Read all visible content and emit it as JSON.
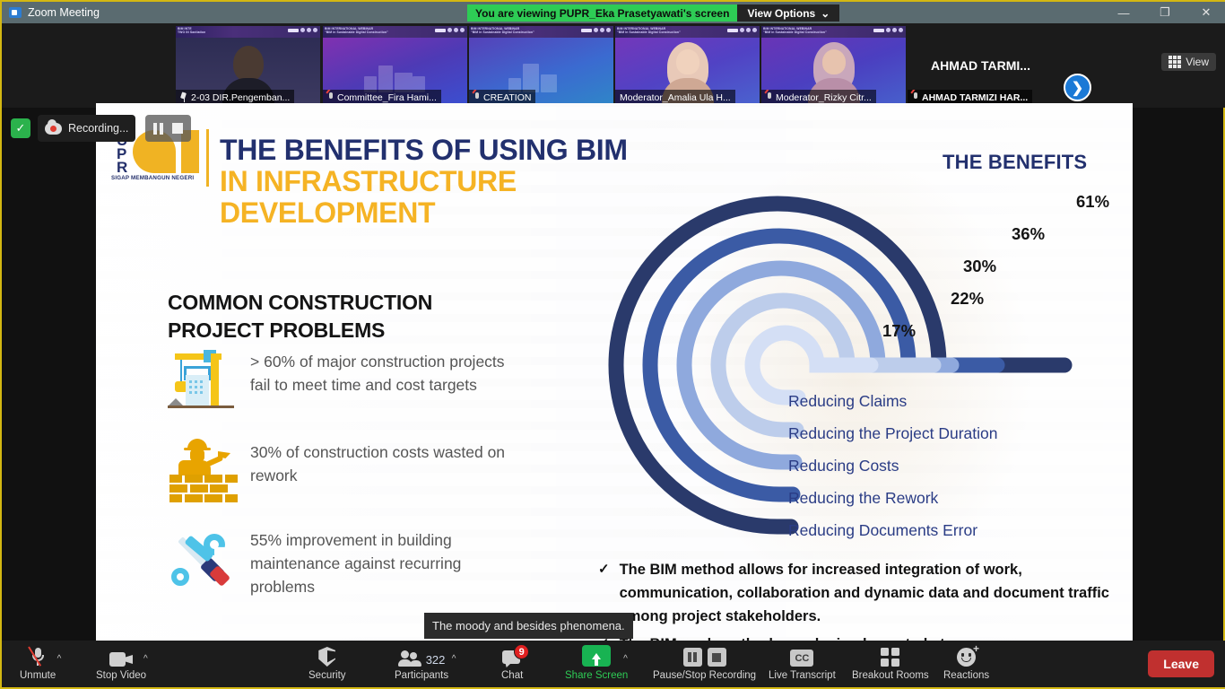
{
  "window": {
    "app_icon": "zoom-icon",
    "title": "Zoom Meeting",
    "viewing_banner": "You are viewing PUPR_Eka Prasetyawati's screen",
    "view_options_label": "View Options",
    "view_options_caret": "⌄",
    "minimize": "—",
    "restore": "❐",
    "close": "✕"
  },
  "filmstrip": {
    "view_button": "View",
    "next_arrow": "❯",
    "tiles": [
      {
        "label": "2-03 DIR.Pengemban...",
        "icon": "pin-icon",
        "active": true,
        "kind": "video"
      },
      {
        "label": "Committee_Fira Hami...",
        "icon": "mic-muted-icon",
        "active": false,
        "kind": "avatar-empty"
      },
      {
        "label": "CREATION",
        "icon": "mic-muted-icon",
        "active": false,
        "kind": "avatar-empty"
      },
      {
        "label": "Moderator_Amalia Ula H...",
        "icon": "",
        "active": false,
        "kind": "video-hijab"
      },
      {
        "label": "Moderator_Rizky Citr...",
        "icon": "mic-muted-icon",
        "active": false,
        "kind": "video-hijab"
      },
      {
        "label": "AHMAD TARMIZI HAR...",
        "icon": "mic-muted-icon",
        "active": false,
        "kind": "name-only",
        "name_display": "AHMAD TARMI..."
      }
    ]
  },
  "recording": {
    "shield_icon": "security-shield-icon",
    "shield_glyph": "✓",
    "cloud_icon": "cloud-recording-icon",
    "status_text": "Recording...",
    "pause_icon": "pause-icon",
    "stop_icon": "stop-icon"
  },
  "slide": {
    "logo": {
      "letters": [
        "U",
        "P",
        "R"
      ],
      "tagline": "SIGAP MEMBANGUN NEGERI"
    },
    "title_line1": "THE BENEFITS OF USING BIM",
    "title_line2": "IN INFRASTRUCTURE",
    "title_line3": "DEVELOPMENT",
    "title_color_1": "#22306e",
    "title_color_2": "#f5b324",
    "problems_heading_l1": "COMMON CONSTRUCTION",
    "problems_heading_l2": "PROJECT PROBLEMS",
    "problems": [
      {
        "icon": "crane-icon",
        "text": "> 60% of major construction projects fail to meet time and cost targets"
      },
      {
        "icon": "mason-bricklayer-icon",
        "text": "30% of construction costs wasted on rework"
      },
      {
        "icon": "wrench-screwdriver-icon",
        "text": "55% improvement in building maintenance against recurring problems"
      }
    ],
    "bullets": [
      "The BIM method allows for increased integration of work, communication, collaboration and dynamic data and document traffic among project stakeholders.",
      "The BIM work methods can be implemented at every"
    ],
    "bullet_marker": "✓"
  },
  "chart_data": {
    "type": "bar",
    "title": "THE BENEFITS",
    "categories": [
      "Reducing Claims",
      "Reducing the Project Duration",
      "Reducing Costs",
      "Reducing the Rework",
      "Reducing Documents Error"
    ],
    "values": [
      17,
      22,
      30,
      36,
      61
    ],
    "value_labels": [
      "17%",
      "22%",
      "30%",
      "36%",
      "61%"
    ],
    "colors": [
      "#d4dff5",
      "#bdcdeb",
      "#8fa9dd",
      "#3b5ba5",
      "#2a3a6b"
    ],
    "xlabel": "",
    "ylabel": "",
    "xlim": [
      0,
      70
    ],
    "grid": false,
    "legend": "right",
    "style_note": "curved radial bars"
  },
  "caption": {
    "text": "The moody and besides phenomena."
  },
  "toolbar": {
    "items": [
      {
        "label": "Unmute",
        "icon": "microphone-muted-icon",
        "caret": "^",
        "badge": ""
      },
      {
        "label": "Stop Video",
        "icon": "camera-icon",
        "caret": "^",
        "badge": ""
      },
      {
        "label": "Security",
        "icon": "shield-icon",
        "caret": "",
        "badge": ""
      },
      {
        "label": "Participants",
        "icon": "participants-icon",
        "caret": "^",
        "badge": "",
        "count": "322"
      },
      {
        "label": "Chat",
        "icon": "chat-bubble-icon",
        "caret": "",
        "badge": "9"
      },
      {
        "label": "Share Screen",
        "icon": "share-screen-icon",
        "caret": "^",
        "badge": "",
        "active": true
      },
      {
        "label": "Pause/Stop Recording",
        "icon": "pause-stop-icon",
        "caret": "",
        "badge": ""
      },
      {
        "label": "Live Transcript",
        "icon": "closed-caption-icon",
        "caret": "",
        "badge": "",
        "glyph": "CC"
      },
      {
        "label": "Breakout Rooms",
        "icon": "breakout-rooms-icon",
        "caret": "",
        "badge": ""
      },
      {
        "label": "Reactions",
        "icon": "reactions-icon",
        "caret": "",
        "badge": ""
      }
    ],
    "leave_label": "Leave"
  }
}
